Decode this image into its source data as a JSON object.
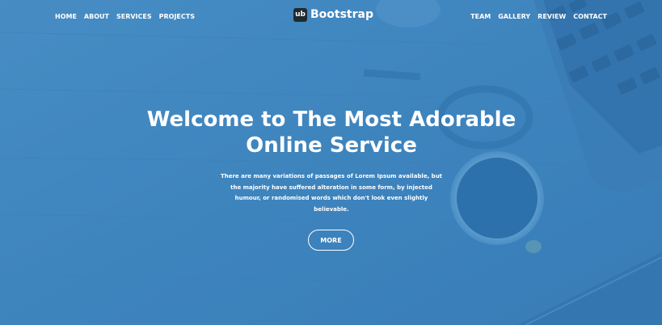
{
  "nav": {
    "left": [
      {
        "label": "HOME"
      },
      {
        "label": "ABOUT"
      },
      {
        "label": "SERVICES"
      },
      {
        "label": "PROJECTS"
      }
    ],
    "right": [
      {
        "label": "TEAM"
      },
      {
        "label": "GALLERY"
      },
      {
        "label": "REVIEW"
      },
      {
        "label": "CONTACT"
      }
    ]
  },
  "brand": {
    "mark": "ub",
    "name": "Bootstrap"
  },
  "hero": {
    "headline_line1": "Welcome to The Most Adorable",
    "headline_line2": "Online Service",
    "subtext": "There are many variations of passages of Lorem Ipsum available, but the majority have suffered alteration in some form, by injected humour, or randomised words which don't look even slightly believable.",
    "button_label": "MORE"
  },
  "colors": {
    "overlay": "#3f86c0",
    "text": "#ffffff",
    "brand_mark": "#1f2a30"
  }
}
